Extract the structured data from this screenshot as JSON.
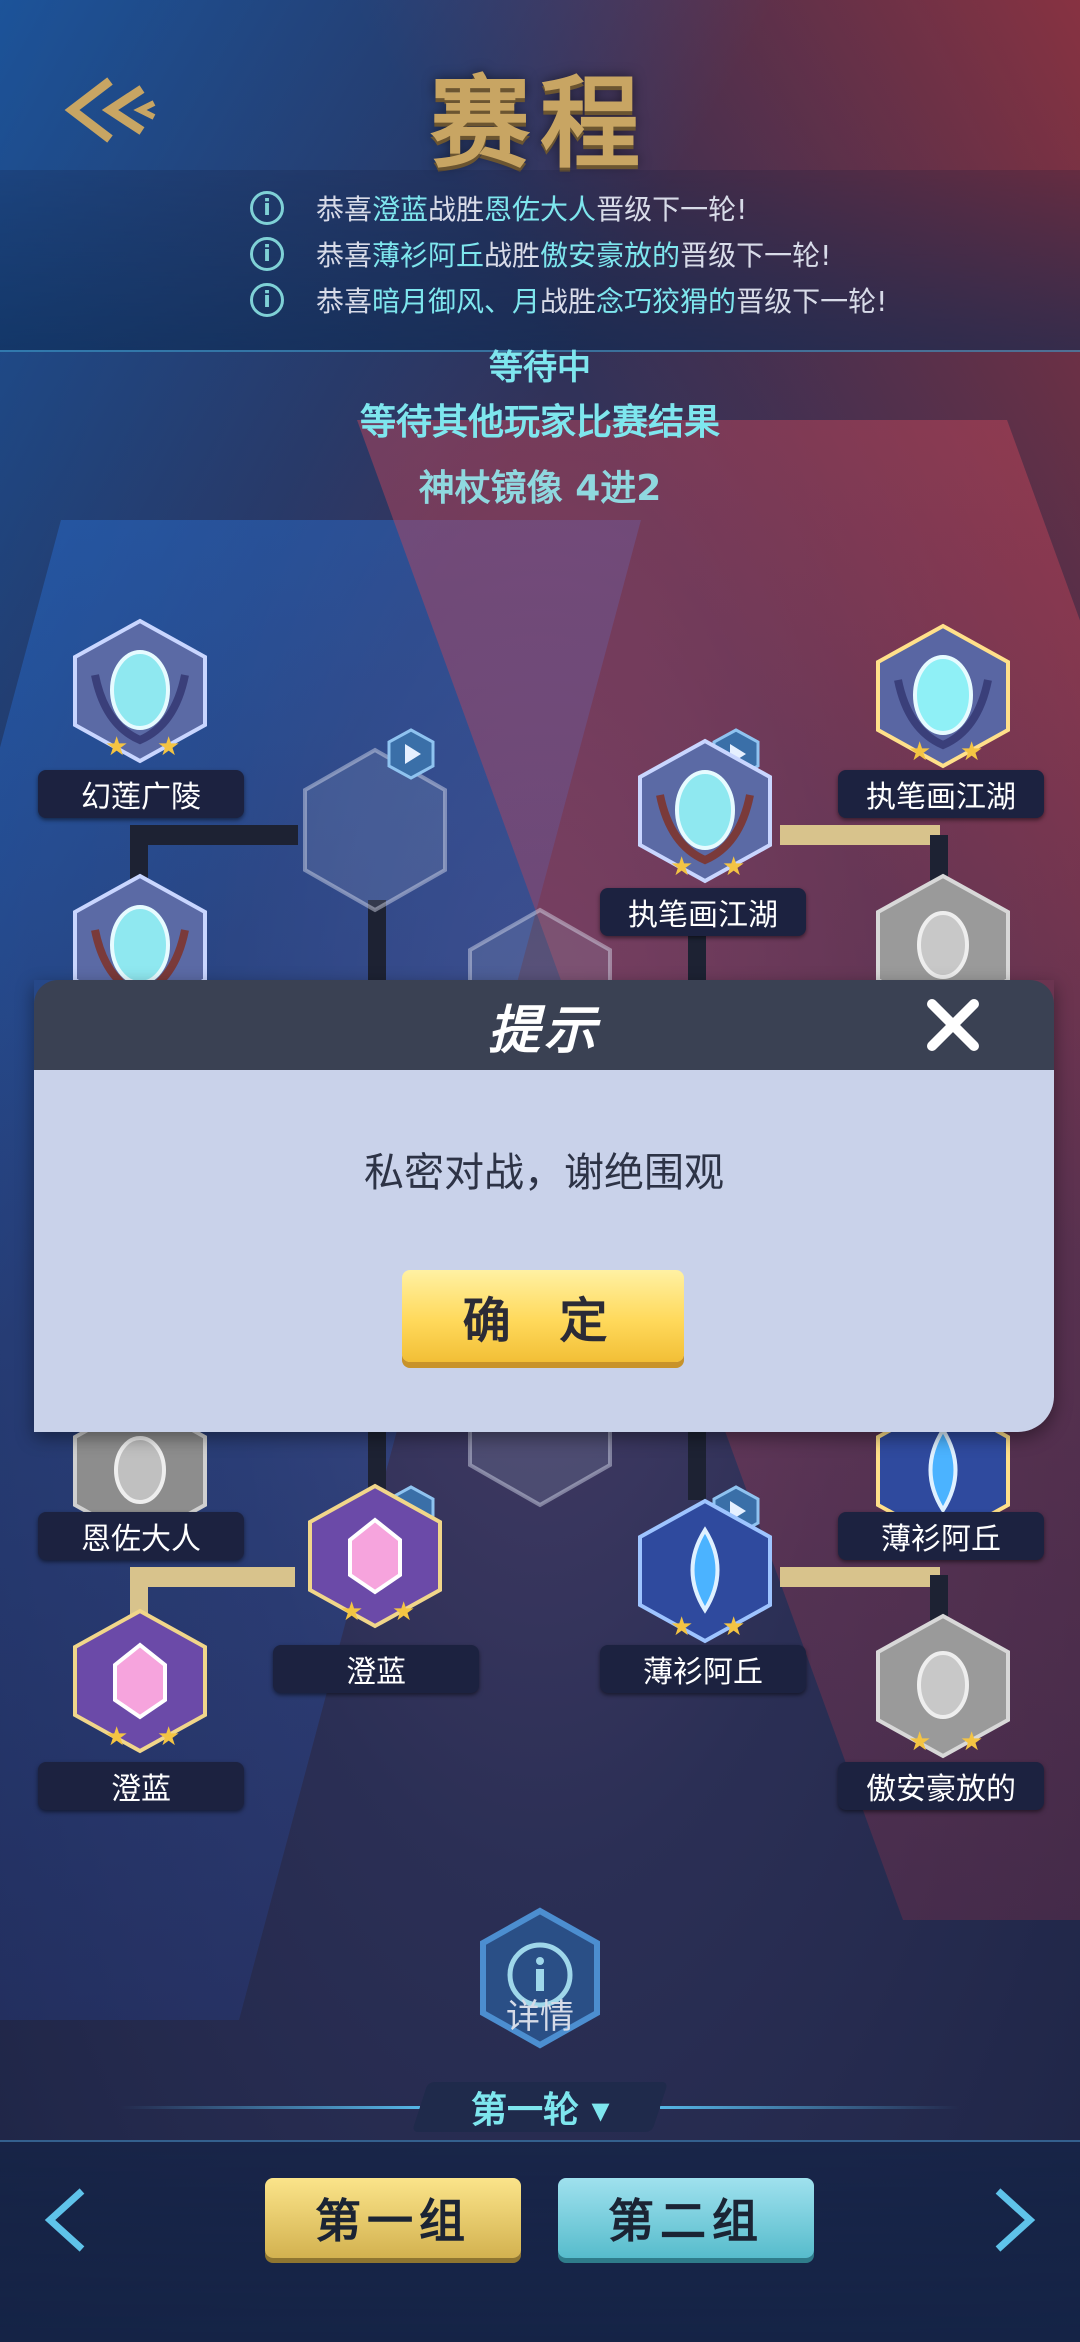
{
  "header": {
    "title": "赛程"
  },
  "notices": [
    {
      "prefix": "恭喜",
      "winner": "澄蓝",
      "mid": "战胜",
      "loser": "恩佐大人",
      "suffix": "晋级下一轮!"
    },
    {
      "prefix": "恭喜",
      "winner": "薄衫阿丘",
      "mid": "战胜",
      "loser": "傲安豪放的",
      "suffix": "晋级下一轮!"
    },
    {
      "prefix": "恭喜",
      "winner": "暗月御风、月",
      "mid": "战胜",
      "loser": "念巧狡猾的",
      "suffix": "晋级下一轮!"
    }
  ],
  "status": {
    "waiting": "等待中",
    "waiting_detail": "等待其他玩家比赛结果",
    "stage": "神杖镜像   4进2"
  },
  "bracket": {
    "names": {
      "top_left": "幻莲广陵",
      "top_right": "执笔画江湖",
      "mid_right": "执笔画江湖",
      "lower_left": "恩佐大人",
      "lower_left_mid": "澄蓝",
      "lower_left_bottom": "澄蓝",
      "lower_right_mid": "薄衫阿丘",
      "lower_right": "薄衫阿丘",
      "lower_right_bottom": "傲安豪放的"
    }
  },
  "modal": {
    "title": "提示",
    "message": "私密对战，谢绝围观",
    "confirm_label": "确 定"
  },
  "footer": {
    "details_label": "详情",
    "round_label": "第一轮 ▾",
    "group1_label": "第一组",
    "group2_label": "第二组"
  },
  "colors": {
    "title_gold": "#c8a563",
    "cyan_text": "#7ee6ee",
    "confirm_yellow": "#ffd95b",
    "modal_header": "#3a4153",
    "modal_body": "#c9d2ea"
  }
}
